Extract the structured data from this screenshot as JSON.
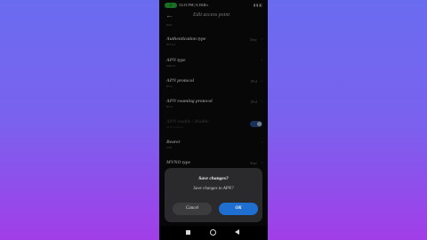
{
  "status": {
    "badge": "0",
    "time": "12:23 PM | 0.1KB/s",
    "right": "▮ ▮ ◧"
  },
  "header": {
    "back_icon": "←",
    "title": "Edit access point"
  },
  "top_sub": "KSA",
  "rows": [
    {
      "label": "Authentication type",
      "sub": "Not set",
      "value": "None"
    },
    {
      "label": "APN type",
      "sub": "default",
      "value": ""
    },
    {
      "label": "APN protocol",
      "sub": "IPv4",
      "value": "IPv4"
    },
    {
      "label": "APN roaming protocol",
      "sub": "IPv4",
      "value": "IPv4"
    },
    {
      "label": "APN enable / disable",
      "sub": "APN enabled",
      "value": ""
    },
    {
      "label": "Bearer",
      "sub": "LTE",
      "value": ""
    },
    {
      "label": "MVNO type",
      "sub": "",
      "value": "None"
    }
  ],
  "dialog": {
    "title": "Save changes?",
    "message": "Save changes to APN?",
    "cancel_label": "Cancel",
    "ok_label": "OK"
  }
}
